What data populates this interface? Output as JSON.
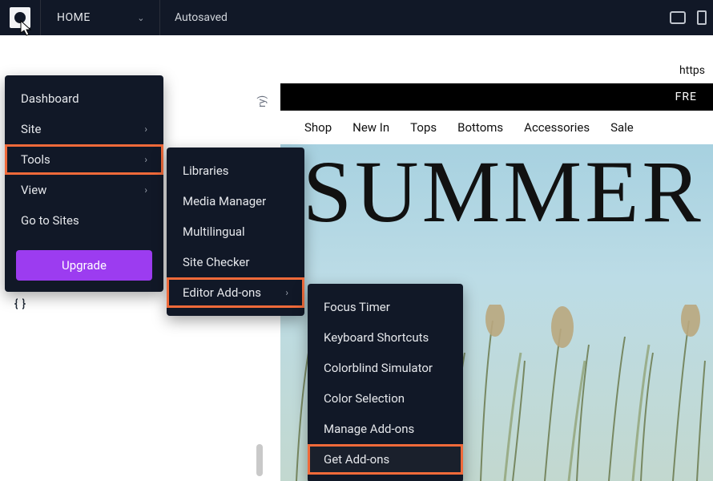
{
  "topbar": {
    "home": "HOME",
    "autosaved": "Autosaved"
  },
  "menu1": {
    "dashboard": "Dashboard",
    "site": "Site",
    "tools": "Tools",
    "view": "View",
    "go_to_sites": "Go to Sites",
    "upgrade": "Upgrade"
  },
  "menu2": {
    "libraries": "Libraries",
    "media_manager": "Media Manager",
    "multilingual": "Multilingual",
    "site_checker": "Site Checker",
    "editor_addons": "Editor Add-ons"
  },
  "menu3": {
    "focus_timer": "Focus Timer",
    "keyboard_shortcuts": "Keyboard Shortcuts",
    "colorblind_simulator": "Colorblind Simulator",
    "color_selection": "Color Selection",
    "manage_addons": "Manage Add-ons",
    "get_addons": "Get Add-ons"
  },
  "site": {
    "banner_text": "FRE",
    "nav": {
      "shop": "Shop",
      "new_in": "New In",
      "tops": "Tops",
      "bottoms": "Bottoms",
      "accessories": "Accessories",
      "sale": "Sale"
    },
    "hero_title": "SUMMER",
    "url_fragment": "https"
  },
  "sidebar_label": "ry)"
}
